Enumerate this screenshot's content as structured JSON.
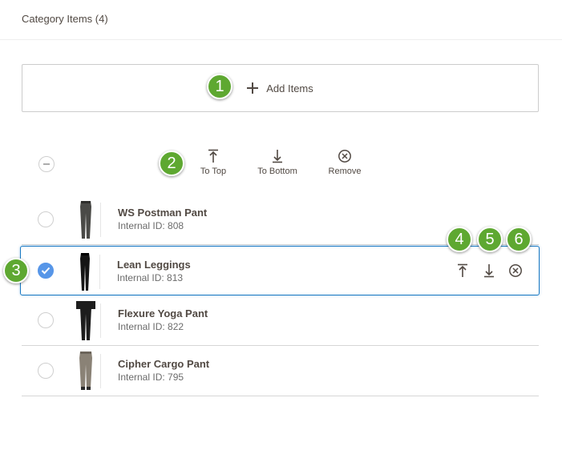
{
  "header": {
    "title": "Category Items (4)"
  },
  "add_items": {
    "label": "Add Items"
  },
  "bulk_actions": {
    "to_top": "To Top",
    "to_bottom": "To Bottom",
    "remove": "Remove"
  },
  "callouts": [
    "1",
    "2",
    "3",
    "4",
    "5",
    "6"
  ],
  "items": [
    {
      "name": "WS Postman Pant",
      "sub": "Internal ID: 808",
      "selected": false
    },
    {
      "name": "Lean Leggings",
      "sub": "Internal ID: 813",
      "selected": true
    },
    {
      "name": "Flexure Yoga Pant",
      "sub": "Internal ID: 822",
      "selected": false
    },
    {
      "name": "Cipher Cargo Pant",
      "sub": "Internal ID: 795",
      "selected": false
    }
  ],
  "colors": {
    "callout_green": "#5ea831",
    "selection_blue": "#1979c3",
    "radio_checked": "#5796e8"
  }
}
